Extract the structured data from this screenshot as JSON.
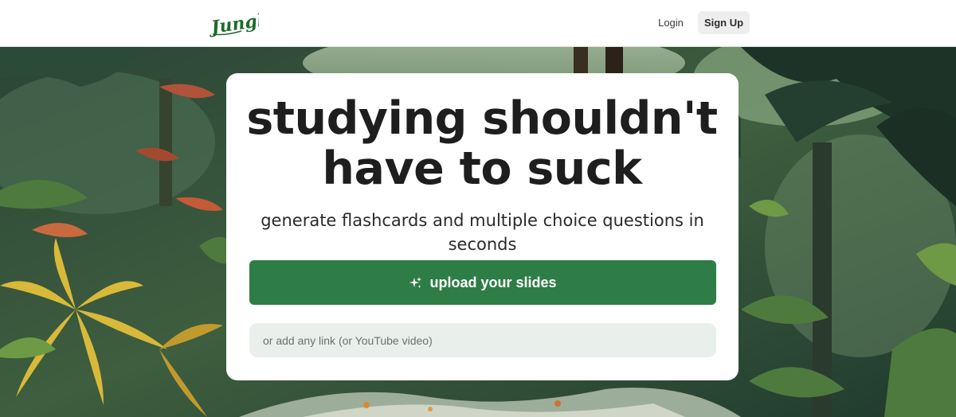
{
  "brand": {
    "logo_text": "Jungle",
    "logo_color": "#1f6b2b"
  },
  "nav": {
    "login_label": "Login",
    "signup_label": "Sign Up"
  },
  "hero": {
    "headline": "studying shouldn't have to suck",
    "subheadline": "generate flashcards and multiple choice questions in seconds",
    "upload_label": "upload your slides",
    "upload_icon": "sparkle-icon",
    "link_placeholder": "or add any link (or YouTube video)"
  },
  "colors": {
    "accent": "#2e7d46",
    "input_bg": "#e9efea",
    "card_bg": "#ffffff",
    "text_dark": "#1e1e1e"
  }
}
